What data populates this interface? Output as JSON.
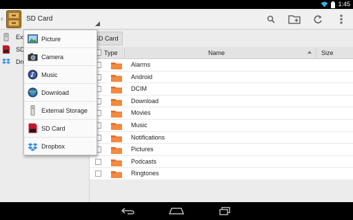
{
  "status_bar": {
    "time": "1:45"
  },
  "action_bar": {
    "title": "SD Card",
    "actions": [
      {
        "name": "search-icon"
      },
      {
        "name": "new-folder-icon"
      },
      {
        "name": "refresh-icon"
      },
      {
        "name": "overflow-menu-icon"
      }
    ]
  },
  "left_pane": {
    "items": [
      {
        "label": "Exte",
        "icon": "external-storage-icon"
      },
      {
        "label": "SD",
        "icon": "sd-card-icon"
      },
      {
        "label": "Dro",
        "icon": "dropbox-icon"
      }
    ]
  },
  "breadcrumb": {
    "label": "SD Card"
  },
  "table": {
    "columns": {
      "type": "Type",
      "name": "Name",
      "size": "Size"
    },
    "rows": [
      {
        "name": "Alarms"
      },
      {
        "name": "Android"
      },
      {
        "name": "DCIM"
      },
      {
        "name": "Download"
      },
      {
        "name": "Movies"
      },
      {
        "name": "Music"
      },
      {
        "name": "Notifications"
      },
      {
        "name": "Pictures"
      },
      {
        "name": "Podcasts"
      },
      {
        "name": "Ringtones"
      }
    ]
  },
  "dropdown": {
    "items": [
      {
        "label": "Picture",
        "icon": "picture-icon"
      },
      {
        "label": "Camera",
        "icon": "camera-icon"
      },
      {
        "label": "Music",
        "icon": "music-icon"
      },
      {
        "label": "Download",
        "icon": "download-icon"
      },
      {
        "label": "External Storage",
        "icon": "external-storage-icon"
      },
      {
        "label": "SD Card",
        "icon": "sd-card-icon"
      },
      {
        "label": "Dropbox",
        "icon": "dropbox-icon"
      }
    ]
  },
  "colors": {
    "accent": "#33b5e5",
    "folder": "#f07a2a",
    "status_bar": "#000000"
  }
}
